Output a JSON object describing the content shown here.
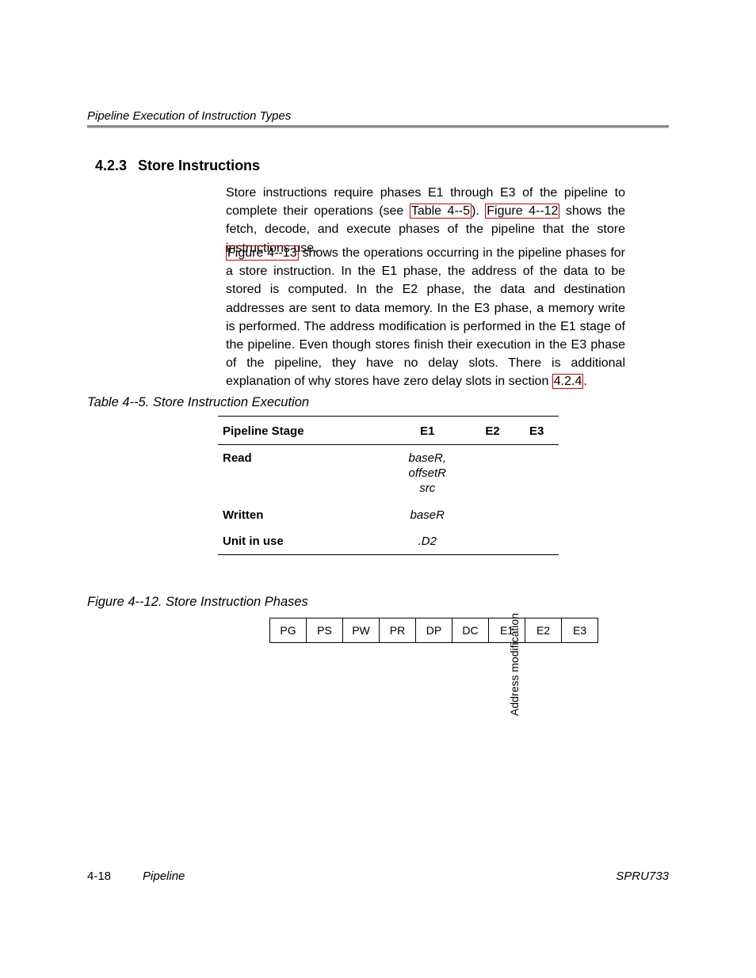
{
  "header": {
    "running": "Pipeline Execution of Instruction Types"
  },
  "section": {
    "number": "4.2.3",
    "title": "Store Instructions"
  },
  "paragraphs": {
    "p1_a": "Store instructions require phases E1 through E3 of the pipeline to complete their operations (see ",
    "ref_tbl": "Table 4--5",
    "p1_b": "). ",
    "ref_fig12": "Figure 4--12",
    "p1_c": " shows the fetch, decode, and execute phases of the pipeline that the store instructions use.",
    "ref_fig13": "Figure 4--13",
    "p2_a": " shows the operations occurring in the pipeline phases for a store instruction. In the E1 phase, the address of the data to be stored is computed. In the E2 phase, the data and destination addresses are sent to data memory. In the E3 phase, a memory write is performed. The address modification is performed in the E1 stage of the pipeline. Even though stores finish their execution in the E3 phase of the pipeline, they have no delay slots. There is additional explanation of why stores have zero delay slots in section ",
    "ref_sec": "4.2.4",
    "p2_b": "."
  },
  "table": {
    "caption": "Table 4--5. Store Instruction Execution",
    "head": {
      "c0": "Pipeline Stage",
      "c1": "E1",
      "c2": "E2",
      "c3": "E3"
    },
    "rows": {
      "r0": {
        "label": "Read",
        "e1": "baseR,\noffsetR\nsrc",
        "e2": "",
        "e3": ""
      },
      "r1": {
        "label": "Written",
        "e1": "baseR",
        "e2": "",
        "e3": ""
      },
      "r2": {
        "label": "Unit in use",
        "e1": ".D2",
        "e2": "",
        "e3": ""
      }
    }
  },
  "figure": {
    "caption": "Figure 4--12. Store Instruction Phases",
    "phases": {
      "p0": "PG",
      "p1": "PS",
      "p2": "PW",
      "p3": "PR",
      "p4": "DP",
      "p5": "DC",
      "p6": "E1",
      "p7": "E2",
      "p8": "E3"
    },
    "annotation": "Address\nmodification"
  },
  "footer": {
    "pagenum": "4-18",
    "chapter": "Pipeline",
    "docid": "SPRU733"
  }
}
